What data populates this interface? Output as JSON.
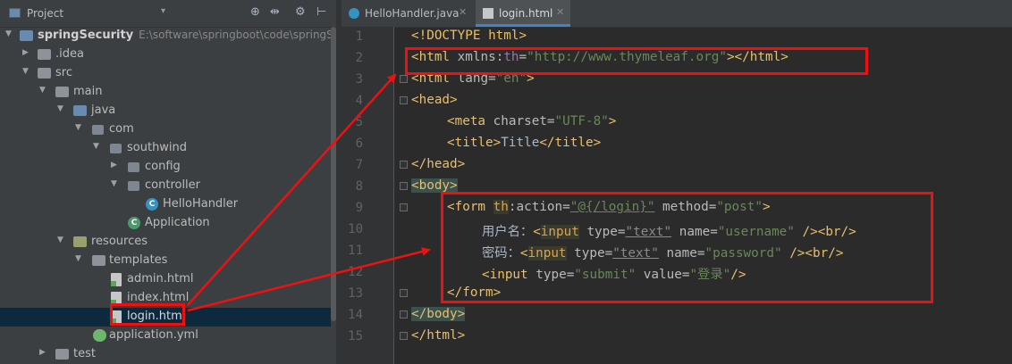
{
  "project_panel": {
    "title": "Project",
    "dropdown": "▾",
    "header_icons": [
      "⊕",
      "⇹",
      "⚙",
      "⊢"
    ]
  },
  "tree": [
    {
      "label": "springSecurity",
      "path": "E:\\software\\springboot\\code\\springSecurit",
      "icon": "module-folder-icon",
      "arrow": "▼",
      "bold": true
    },
    {
      "label": ".idea",
      "icon": "folder-icon",
      "arrow": "▶"
    },
    {
      "label": "src",
      "icon": "folder-icon",
      "arrow": "▼"
    },
    {
      "label": "main",
      "icon": "folder-icon",
      "arrow": "▼"
    },
    {
      "label": "java",
      "icon": "source-folder-icon",
      "arrow": "▼"
    },
    {
      "label": "com",
      "icon": "package-icon",
      "arrow": "▼"
    },
    {
      "label": "southwind",
      "icon": "package-icon",
      "arrow": "▼"
    },
    {
      "label": "config",
      "icon": "package-icon",
      "arrow": "▶"
    },
    {
      "label": "controller",
      "icon": "package-icon",
      "arrow": "▼"
    },
    {
      "label": "HelloHandler",
      "icon": "class-icon",
      "arrow": ""
    },
    {
      "label": "Application",
      "icon": "spring-class-icon",
      "arrow": ""
    },
    {
      "label": "resources",
      "icon": "resources-folder-icon",
      "arrow": "▼"
    },
    {
      "label": "templates",
      "icon": "folder-icon",
      "arrow": "▼"
    },
    {
      "label": "admin.html",
      "icon": "html-file-icon",
      "arrow": ""
    },
    {
      "label": "index.html",
      "icon": "html-file-icon",
      "arrow": ""
    },
    {
      "label": "login.html",
      "icon": "html-file-icon",
      "arrow": "",
      "selected": true
    },
    {
      "label": "application.yml",
      "icon": "yml-file-icon",
      "arrow": ""
    },
    {
      "label": "test",
      "icon": "folder-icon",
      "arrow": "▶"
    }
  ],
  "tabs": [
    {
      "label": "HelloHandler.java",
      "icon": "class-icon",
      "close": "✕"
    },
    {
      "label": "login.html",
      "icon": "html-file-icon",
      "close": "✕",
      "active": true
    }
  ],
  "line_numbers": [
    "1",
    "2",
    "3",
    "4",
    "5",
    "6",
    "7",
    "8",
    "9",
    "10",
    "11",
    "12",
    "13",
    "14",
    "15"
  ],
  "code": {
    "l1": "<!DOCTYPE html>",
    "l2_a": "<html ",
    "l2_b": "xmlns:",
    "l2_c": "th",
    "l2_d": "=",
    "l2_e": "\"http://www.thymeleaf.org\"",
    "l2_f": "></html>",
    "l3_a": "<html ",
    "l3_b": "lang",
    "l3_c": "=",
    "l3_d": "\"en\"",
    "l3_e": ">",
    "l4": "<head>",
    "l5_a": "<meta ",
    "l5_b": "charset",
    "l5_c": "=",
    "l5_d": "\"UTF-8\"",
    "l5_e": ">",
    "l6_a": "<title>",
    "l6_b": "Title",
    "l6_c": "</title>",
    "l7": "</head>",
    "l8": "<body>",
    "l9_a": "<form ",
    "l9_b": "th",
    "l9_c": ":action",
    "l9_d": "=",
    "l9_e": "\"@{/login}\"",
    "l9_f": " method",
    "l9_g": "=",
    "l9_h": "\"post\"",
    "l9_i": ">",
    "l10_a": "用户名：",
    "l10_b": "<",
    "l10_c": "input",
    "l10_d": " type",
    "l10_e": "=",
    "l10_f": "\"text\"",
    "l10_g": " name",
    "l10_h": "=",
    "l10_i": "\"username\"",
    "l10_j": " />",
    "l10_k": "<br/>",
    "l11_a": "密码：",
    "l11_b": "<",
    "l11_c": "input",
    "l11_d": " type",
    "l11_e": "=",
    "l11_f": "\"text\"",
    "l11_g": " name",
    "l11_h": "=",
    "l11_i": "\"password\"",
    "l11_j": " />",
    "l11_k": "<br/>",
    "l12_a": "<input ",
    "l12_b": "type",
    "l12_c": "=",
    "l12_d": "\"submit\"",
    "l12_e": " value",
    "l12_f": "=",
    "l12_g": "\"登录\"",
    "l12_h": "/>",
    "l13": "</form>",
    "l14_a": "</body",
    "l14_b": ">",
    "l15": "</html>"
  },
  "colors": {
    "annotation": "#ee1111",
    "tag": "#e8bf6a",
    "string": "#6a8759",
    "selection": "#0d293e"
  }
}
